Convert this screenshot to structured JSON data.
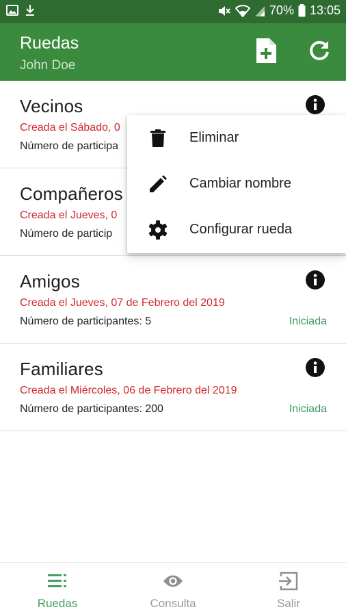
{
  "status_bar": {
    "battery": "70%",
    "time": "13:05",
    "icons": [
      "image-icon",
      "download-icon",
      "mute-icon",
      "wifi-icon",
      "signal-icon",
      "battery-icon"
    ]
  },
  "app_bar": {
    "title": "Ruedas",
    "subtitle": "John Doe",
    "actions": [
      "new-file-icon",
      "refresh-icon"
    ]
  },
  "ruedas": [
    {
      "name": "Vecinos",
      "date": "Creada el Sábado, 0",
      "participants": "Número de participa",
      "status": ""
    },
    {
      "name": "Compañeros",
      "date": "Creada el Jueves, 0",
      "participants": "Número de particip",
      "status": ""
    },
    {
      "name": "Amigos",
      "date": "Creada el Jueves, 07 de Febrero del 2019",
      "participants": "Número de participantes: 5",
      "status": "Iniciada"
    },
    {
      "name": "Familiares",
      "date": "Creada el Miércoles, 06 de Febrero del 2019",
      "participants": "Número de participantes: 200",
      "status": "Iniciada"
    }
  ],
  "menu": {
    "items": [
      {
        "label": "Eliminar",
        "icon": "trash-icon"
      },
      {
        "label": "Cambiar nombre",
        "icon": "pencil-icon"
      },
      {
        "label": "Configurar rueda",
        "icon": "gear-icon"
      }
    ]
  },
  "bottom_nav": {
    "items": [
      {
        "label": "Ruedas",
        "icon": "list-icon",
        "active": true
      },
      {
        "label": "Consulta",
        "icon": "eye-icon",
        "active": false
      },
      {
        "label": "Salir",
        "icon": "exit-icon",
        "active": false
      }
    ]
  },
  "colors": {
    "status_bar": "#2e6b30",
    "app_bar": "#3a8b3d",
    "date_red": "#d0282b",
    "status_green": "#3d9a5b",
    "nav_active": "#46a05b",
    "nav_inactive": "#9a9a9a"
  }
}
